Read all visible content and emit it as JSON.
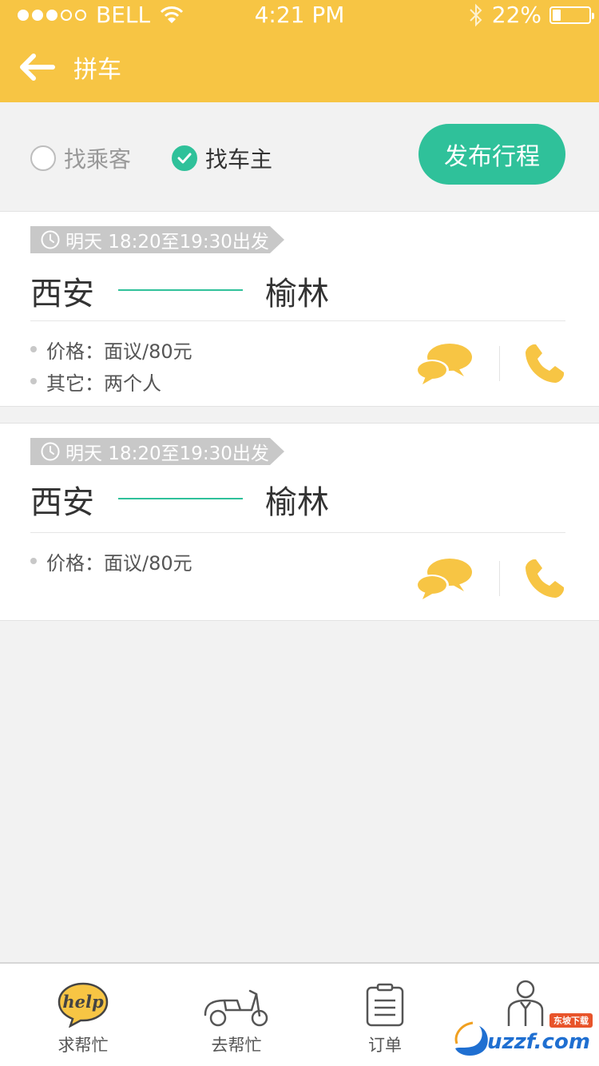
{
  "status_bar": {
    "carrier": "BELL",
    "time": "4:21 PM",
    "battery": "22%",
    "battery_level": 0.22
  },
  "nav": {
    "title": "拼车"
  },
  "filter": {
    "options": [
      {
        "label": "找乘客",
        "selected": false
      },
      {
        "label": "找车主",
        "selected": true
      }
    ],
    "publish_label": "发布行程"
  },
  "trips": [
    {
      "time": "明天 18:20至19:30出发",
      "from": "西安",
      "to": "榆林",
      "details": [
        "价格：面议/80元",
        "其它：两个人"
      ]
    },
    {
      "time": "明天 18:20至19:30出发",
      "from": "西安",
      "to": "榆林",
      "details": [
        "价格：面议/80元"
      ]
    }
  ],
  "tabs": [
    {
      "label": "求帮忙",
      "icon": "help-bubble-icon",
      "icon_text": "help"
    },
    {
      "label": "去帮忙",
      "icon": "scooter-icon"
    },
    {
      "label": "订单",
      "icon": "clipboard-icon"
    },
    {
      "label": "",
      "icon": "person-icon"
    }
  ],
  "watermark": {
    "text": "uzzf.com",
    "badge": "东坡下载"
  },
  "colors": {
    "brand_yellow": "#f7c544",
    "accent_green": "#2fc19a",
    "tag_gray": "#c8c8c8",
    "icon_yellow": "#f7c544"
  }
}
